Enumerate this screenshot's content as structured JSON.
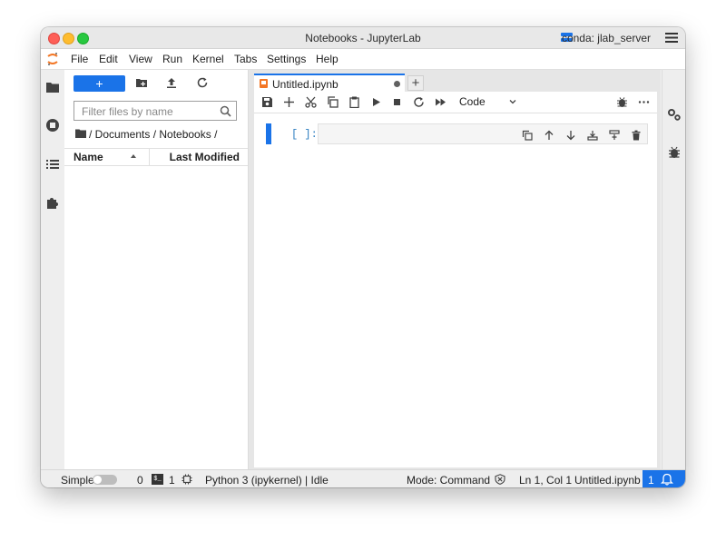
{
  "window": {
    "title": "Notebooks - JupyterLab",
    "env_label": "conda: jlab_server"
  },
  "menu": {
    "items": [
      "File",
      "Edit",
      "View",
      "Run",
      "Kernel",
      "Tabs",
      "Settings",
      "Help"
    ]
  },
  "filebrowser": {
    "new_button_label": "+",
    "filter_placeholder": "Filter files by name",
    "breadcrumb": "/ Documents / Notebooks /",
    "columns": {
      "name": "Name",
      "modified": "Last Modified"
    }
  },
  "tabs": [
    {
      "title": "Untitled.ipynb",
      "dirty": true
    }
  ],
  "notebook": {
    "cell_type": "Code",
    "cells": [
      {
        "prompt": "[ ]:",
        "source": ""
      }
    ]
  },
  "statusbar": {
    "mode_label": "Simple",
    "kernels_count": "0",
    "terminals_count": "1",
    "terminal_icon_text": "$_",
    "kernel": "Python 3 (ipykernel) | Idle",
    "mode": "Mode: Command",
    "position": "Ln 1, Col 1",
    "filename": "Untitled.ipynb",
    "notifications": "1"
  },
  "colors": {
    "accent": "#1a73e8",
    "prompt": "#307fc1"
  },
  "icons": {
    "left_sidebar": [
      "folder-icon",
      "running-icon",
      "toc-icon",
      "extension-icon"
    ],
    "right_sidebar": [
      "property-inspector-icon",
      "debugger-icon"
    ]
  }
}
